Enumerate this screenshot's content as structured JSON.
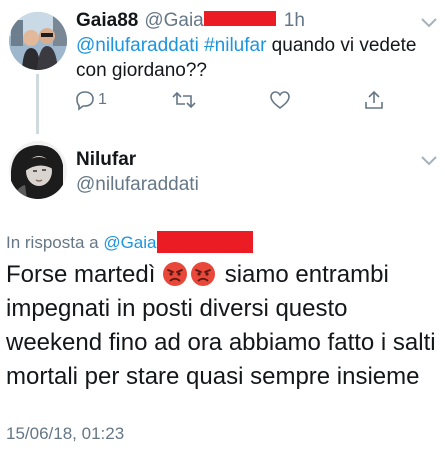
{
  "reply_tweet": {
    "display_name": "Gaia88",
    "handle": "@Gaia",
    "time": "1h",
    "text_mentions": "@nilufaraddati #nilufar",
    "text_body": " quando vi vedete con giordano??",
    "reply_count": "1",
    "icons": [
      "reply-icon",
      "retweet-icon",
      "like-icon",
      "share-icon",
      "chevron-down-icon"
    ]
  },
  "main_tweet": {
    "display_name": "Nilufar",
    "handle": "@nilufaraddati",
    "reply_prefix": "In risposta a ",
    "reply_mention": "@Gaia",
    "text_part1": "Forse martedì ",
    "text_part2": " siamo entrambi impegnati in posti diversi questo weekend fino ad ora abbiamo fatto i salti mortali per stare quasi sempre insieme",
    "emojis": [
      "angry-face-emoji",
      "angry-face-emoji"
    ],
    "timestamp": "15/06/18, 01:23"
  },
  "colors": {
    "link": "#1b95e0",
    "secondary_text": "#657786",
    "redaction": "#ec1c24",
    "thread_line": "#cfd9de"
  }
}
